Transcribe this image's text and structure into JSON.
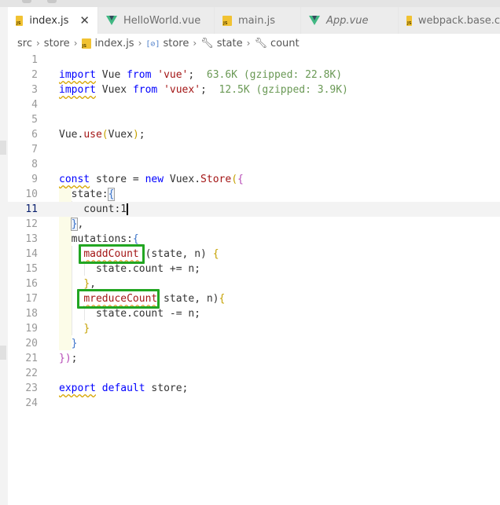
{
  "tabs": [
    {
      "label": "index.js",
      "icon": "js-file-icon",
      "active": true,
      "closable": true
    },
    {
      "label": "HelloWorld.vue",
      "icon": "vue-file-icon",
      "active": false
    },
    {
      "label": "main.js",
      "icon": "js-file-icon",
      "active": false
    },
    {
      "label": "App.vue",
      "icon": "vue-file-icon",
      "active": false,
      "italic": true
    },
    {
      "label": "webpack.base.c",
      "icon": "js-file-icon",
      "active": false
    }
  ],
  "close_glyph": "✕",
  "breadcrumb": [
    "src",
    "store",
    "index.js",
    "store",
    "state",
    "count"
  ],
  "breadcrumb_sep": "›",
  "editor": {
    "current_line": 11,
    "lines": [
      {
        "n": "1"
      },
      {
        "n": "2",
        "parts": [
          "import",
          " Vue ",
          "from",
          " ",
          "'vue'",
          ";",
          "  63.6K (gzipped: 22.8K)"
        ]
      },
      {
        "n": "3",
        "parts": [
          "import",
          " Vuex ",
          "from",
          " ",
          "'vuex'",
          ";",
          "  12.5K (gzipped: 3.9K)"
        ]
      },
      {
        "n": "4"
      },
      {
        "n": "5"
      },
      {
        "n": "6",
        "parts": [
          "Vue.",
          "use",
          "(",
          "Vuex",
          ")",
          ";"
        ]
      },
      {
        "n": "7"
      },
      {
        "n": "8"
      },
      {
        "n": "9",
        "parts": [
          "const",
          " store = ",
          "new",
          " Vuex.",
          "Store",
          "(",
          "{"
        ]
      },
      {
        "n": "10",
        "parts": [
          "  state:",
          "{"
        ]
      },
      {
        "n": "11",
        "parts": [
          "    count:",
          "1"
        ]
      },
      {
        "n": "12",
        "parts": [
          "  ",
          "}",
          ","
        ]
      },
      {
        "n": "13",
        "parts": [
          "  mutations:",
          "{"
        ]
      },
      {
        "n": "14",
        "parts": [
          "    ",
          "maddCount",
          " (state, n) ",
          "{"
        ]
      },
      {
        "n": "15",
        "parts": [
          "      state.count += n;"
        ]
      },
      {
        "n": "16",
        "parts": [
          "    ",
          "}",
          ","
        ]
      },
      {
        "n": "17",
        "parts": [
          "    ",
          "mreduceCount",
          " state, n)",
          "{"
        ]
      },
      {
        "n": "18",
        "parts": [
          "      state.count -= n;"
        ]
      },
      {
        "n": "19",
        "parts": [
          "    ",
          "}"
        ]
      },
      {
        "n": "20",
        "parts": [
          "  ",
          "}"
        ]
      },
      {
        "n": "21",
        "parts": [
          "})",
          ";"
        ]
      },
      {
        "n": "22"
      },
      {
        "n": "23",
        "parts": [
          "export",
          " ",
          "default",
          " store;"
        ]
      },
      {
        "n": "24"
      }
    ]
  },
  "colors": {
    "keyword": "#0000ff",
    "string": "#a31515",
    "size_hint": "#6a9955",
    "annotation_box": "#22a622",
    "current_line_bg": "#f3f3f3"
  }
}
